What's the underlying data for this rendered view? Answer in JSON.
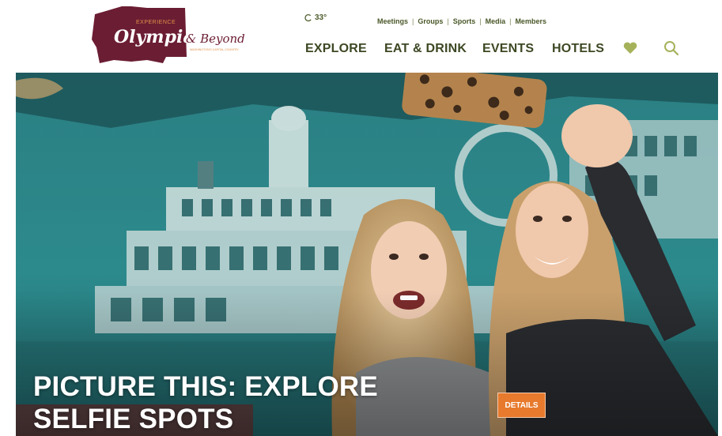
{
  "logo": {
    "experience": "EXPERIENCE",
    "olympia": "Olympia",
    "beyond": "& Beyond",
    "tagline": "WASHINGTON'S CAPITAL COUNTRY",
    "alt": "Experience Olympia & Beyond"
  },
  "weather": {
    "temp": "33°",
    "icon": "weather-icon"
  },
  "utility_nav": [
    {
      "label": "Meetings"
    },
    {
      "label": "Groups"
    },
    {
      "label": "Sports"
    },
    {
      "label": "Media"
    },
    {
      "label": "Members"
    }
  ],
  "utility_separator": "|",
  "main_nav": [
    {
      "label": "EXPLORE"
    },
    {
      "label": "EAT & DRINK"
    },
    {
      "label": "EVENTS"
    },
    {
      "label": "HOTELS"
    }
  ],
  "icons": {
    "favorites": "heart-icon",
    "search": "search-icon"
  },
  "hero": {
    "title_line1": "PICTURE THIS: EXPLORE",
    "title_line2": "SELFIE SPOTS",
    "button_label": "DETAILS"
  },
  "colors": {
    "brand_maroon": "#6b1d33",
    "nav_text": "#3d4823",
    "accent_green": "#a6b25a",
    "button_orange": "#e77a2d"
  }
}
